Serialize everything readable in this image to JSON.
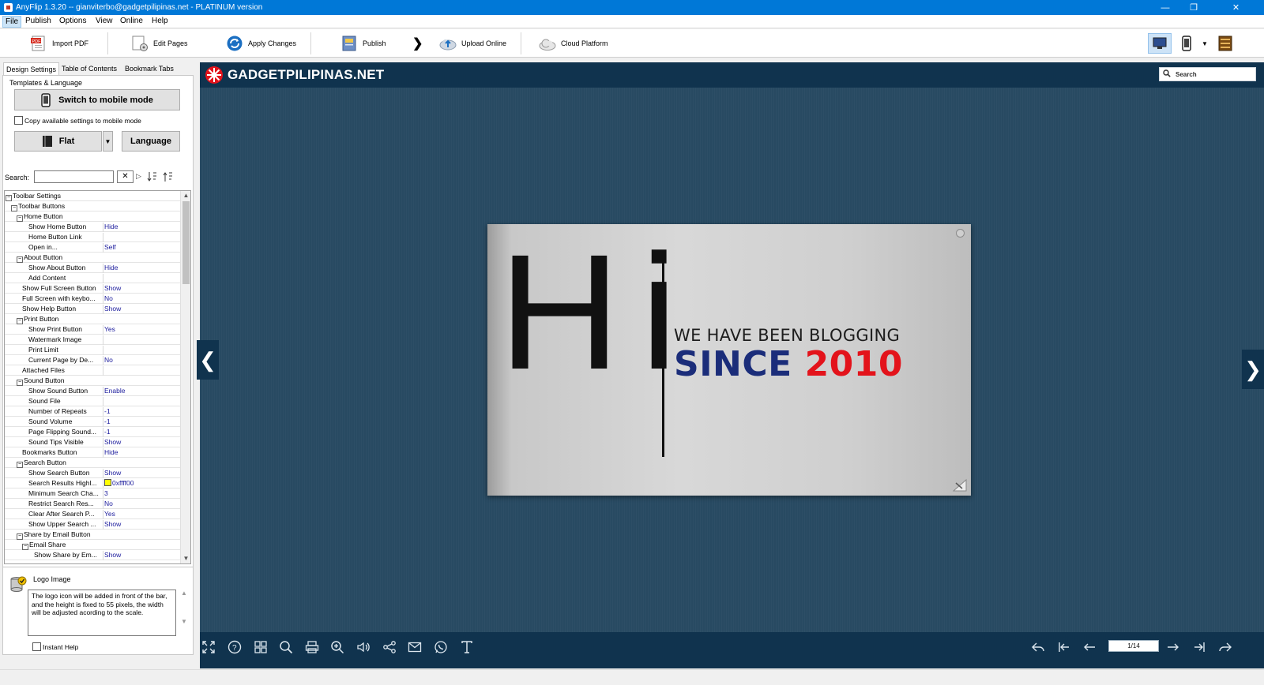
{
  "window": {
    "title": "AnyFlip 1.3.20  -- gianviterbo@gadgetpilipinas.net - PLATINUM version"
  },
  "menu": [
    "File",
    "Publish",
    "Options",
    "View",
    "Online",
    "Help"
  ],
  "toolbar": {
    "import_pdf": "Import PDF",
    "edit_pages": "Edit Pages",
    "apply_changes": "Apply Changes",
    "publish": "Publish",
    "upload_online": "Upload Online",
    "cloud_platform": "Cloud Platform"
  },
  "panel": {
    "tabs": [
      "Design Settings",
      "Table of Contents",
      "Bookmark Tabs"
    ],
    "templates_label": "Templates & Language",
    "switch_mobile": "Switch to mobile mode",
    "copy_settings": "Copy available settings to mobile mode",
    "template_name": "Flat",
    "language": "Language",
    "search_label": "Search:"
  },
  "tree": [
    {
      "k": "Toolbar Settings",
      "v": "",
      "lvl": 0,
      "ex": "-"
    },
    {
      "k": "Toolbar Buttons",
      "v": "",
      "lvl": 1,
      "ex": "-"
    },
    {
      "k": "Home Button",
      "v": "",
      "lvl": 2,
      "ex": "-"
    },
    {
      "k": "Show Home Button",
      "v": "Hide",
      "lvl": 4
    },
    {
      "k": "Home Button Link",
      "v": "",
      "lvl": 4
    },
    {
      "k": "Open in...",
      "v": "Self",
      "lvl": 4
    },
    {
      "k": "About Button",
      "v": "",
      "lvl": 2,
      "ex": "-"
    },
    {
      "k": "Show About Button",
      "v": "Hide",
      "lvl": 4
    },
    {
      "k": "Add Content",
      "v": "",
      "lvl": 4
    },
    {
      "k": "Show Full Screen Button",
      "v": "Show",
      "lvl": 3
    },
    {
      "k": "Full Screen with keybo...",
      "v": "No",
      "lvl": 3
    },
    {
      "k": "Show Help Button",
      "v": "Show",
      "lvl": 3
    },
    {
      "k": "Print Button",
      "v": "",
      "lvl": 2,
      "ex": "-"
    },
    {
      "k": "Show Print Button",
      "v": "Yes",
      "lvl": 4
    },
    {
      "k": "Watermark Image",
      "v": "",
      "lvl": 4
    },
    {
      "k": "Print Limit",
      "v": "",
      "lvl": 4
    },
    {
      "k": "Current Page by De...",
      "v": "No",
      "lvl": 4
    },
    {
      "k": "Attached Files",
      "v": "",
      "lvl": 3
    },
    {
      "k": "Sound Button",
      "v": "",
      "lvl": 2,
      "ex": "-"
    },
    {
      "k": "Show Sound Button",
      "v": "Enable",
      "lvl": 4
    },
    {
      "k": "Sound File",
      "v": "",
      "lvl": 4
    },
    {
      "k": "Number of Repeats",
      "v": "-1",
      "lvl": 4
    },
    {
      "k": "Sound Volume",
      "v": "-1",
      "lvl": 4
    },
    {
      "k": "Page Flipping Sound...",
      "v": "-1",
      "lvl": 4
    },
    {
      "k": "Sound Tips Visible",
      "v": "Show",
      "lvl": 4
    },
    {
      "k": "Bookmarks Button",
      "v": "Hide",
      "lvl": 3
    },
    {
      "k": "Search Button",
      "v": "",
      "lvl": 2,
      "ex": "-"
    },
    {
      "k": "Show Search Button",
      "v": "Show",
      "lvl": 4
    },
    {
      "k": "Search Results Highl...",
      "v": "0xffff00",
      "lvl": 4,
      "swatch": "#ffff00"
    },
    {
      "k": "Minimum Search Cha...",
      "v": "3",
      "lvl": 4
    },
    {
      "k": "Restrict Search Res...",
      "v": "No",
      "lvl": 4
    },
    {
      "k": "Clear After Search P...",
      "v": "Yes",
      "lvl": 4
    },
    {
      "k": "Show Upper Search ...",
      "v": "Show",
      "lvl": 4
    },
    {
      "k": "Share by Email Button",
      "v": "",
      "lvl": 2,
      "ex": "-"
    },
    {
      "k": "Email Share",
      "v": "",
      "lvl": 3,
      "ex": "-"
    },
    {
      "k": "Show Share by Em...",
      "v": "Show",
      "lvl": 5
    }
  ],
  "help": {
    "title": "Logo Image",
    "text": "The logo icon will be added in front of the bar, and the height is fixed to 55 pixels, the width will be adjusted acording to the scale.",
    "instant_help": "Instant Help"
  },
  "preview": {
    "logo": "GADGETPILIPINAS.NET",
    "search": "Search",
    "page": {
      "hi": "Hi",
      "line1": "WE HAVE BEEN BLOGGING",
      "line2a": "SINCE ",
      "line2b": "2010"
    },
    "page_indicator": "1/14"
  },
  "colors": {
    "titlebar": "#0078d7",
    "preview_bg": "#284a62",
    "preview_bar": "#10334e",
    "since": "#1b2d7a",
    "year": "#e3131b"
  },
  "footer_icons": [
    "fullscreen-icon",
    "help-icon",
    "thumbnails-icon",
    "search-icon",
    "print-icon",
    "zoom-in-icon",
    "sound-icon",
    "share-icon",
    "email-icon",
    "whatsapp-icon",
    "text-icon"
  ],
  "nav_icons": [
    "back-icon",
    "first-page-icon",
    "prev-page-icon",
    "next-page-icon",
    "last-page-icon",
    "forward-icon"
  ]
}
